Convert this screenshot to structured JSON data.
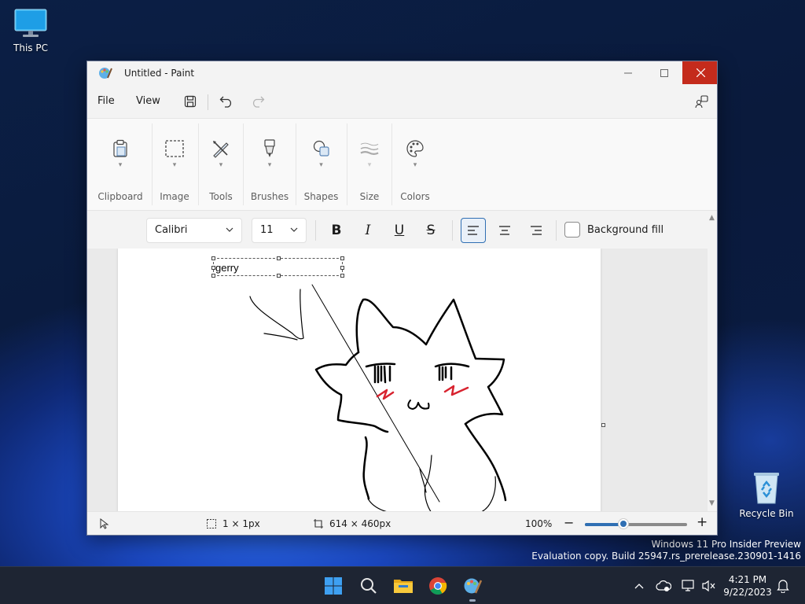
{
  "desktop": {
    "this_pc_label": "This PC",
    "recycle_bin_label": "Recycle Bin",
    "watermark_line1": "Windows 11 Pro Insider Preview",
    "watermark_line2": "Evaluation copy. Build 25947.rs_prerelease.230901-1416"
  },
  "window": {
    "title": "Untitled - Paint",
    "close_color": "#c42b1c"
  },
  "menu": {
    "file": "File",
    "view": "View"
  },
  "ribbon": {
    "groups": [
      {
        "label": "Clipboard",
        "icon": "clipboard-icon"
      },
      {
        "label": "Image",
        "icon": "selection-icon"
      },
      {
        "label": "Tools",
        "icon": "tools-icon"
      },
      {
        "label": "Brushes",
        "icon": "brush-icon"
      },
      {
        "label": "Shapes",
        "icon": "shapes-icon"
      },
      {
        "label": "Size",
        "icon": "size-icon"
      },
      {
        "label": "Colors",
        "icon": "palette-icon"
      }
    ]
  },
  "text_toolbar": {
    "font": "Calibri",
    "size": "11",
    "bold": "B",
    "italic": "I",
    "underline": "U",
    "strike": "S",
    "background_fill": "Background fill",
    "accent": "#2f6fb3"
  },
  "canvas": {
    "text_content": "gerry"
  },
  "status": {
    "selection_size": "1 × 1px",
    "canvas_size": "614 × 460px",
    "zoom": "100%",
    "zoom_level": 0.38
  },
  "taskbar": {
    "time": "4:21 PM",
    "date": "9/22/2023"
  }
}
